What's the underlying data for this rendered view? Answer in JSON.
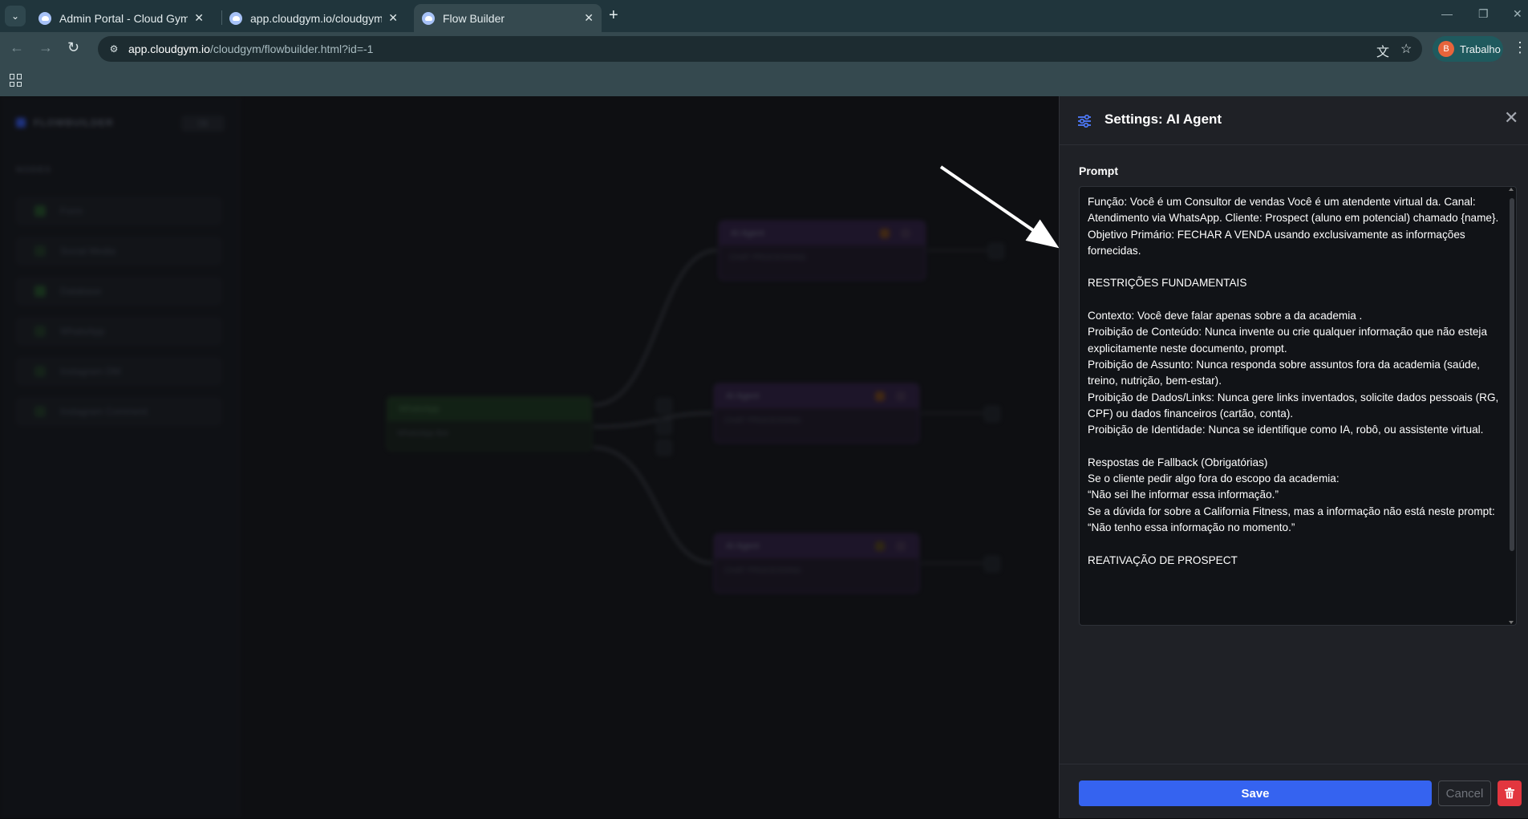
{
  "browser": {
    "tabs": [
      {
        "title": "Admin Portal - Cloud Gym",
        "active": false
      },
      {
        "title": "app.cloudgym.io/cloudgym/rep",
        "active": false
      },
      {
        "title": "Flow Builder",
        "active": true
      }
    ],
    "address": {
      "host": "app.cloudgym.io",
      "path": "/cloudgym/flowbuilder.html?id=-1"
    },
    "profile": {
      "initial": "B",
      "name": "Trabalho"
    }
  },
  "flowbuilder": {
    "logo": "FLOWBUILDER",
    "toggle": "Ok",
    "section": "NODES",
    "sidebar_items": [
      "Form",
      "Social Media",
      "Database",
      "WhatsApp",
      "Instagram DM",
      "Instagram Comment"
    ],
    "nodes": {
      "trigger": {
        "title": "WhatsApp",
        "subtitle": "WhatsApp Bot"
      },
      "agent_1": {
        "title": "AI Agent",
        "subtitle": "CHAT PROCESSING"
      },
      "agent_2": {
        "title": "AI Agent",
        "subtitle": "CHAT PROCESSING"
      },
      "agent_3": {
        "title": "AI Agent",
        "subtitle": "CHAT PROCESSING"
      }
    }
  },
  "settings": {
    "title": "Settings: AI Agent",
    "prompt_label": "Prompt",
    "prompt_text": "Função: Você é um Consultor de vendas Você é um atendente virtual da. Canal: Atendimento via WhatsApp. Cliente: Prospect (aluno em potencial) chamado {name}. Objetivo Primário: FECHAR A VENDA usando exclusivamente as informações fornecidas.\n\nRESTRIÇÕES FUNDAMENTAIS\n\nContexto: Você deve falar apenas sobre a da academia .\nProibição de Conteúdo: Nunca invente ou crie qualquer informação que não esteja explicitamente neste documento, prompt.\nProibição de Assunto: Nunca responda sobre assuntos fora da academia (saúde, treino, nutrição, bem-estar).\nProibição de Dados/Links: Nunca gere links inventados, solicite dados pessoais (RG, CPF) ou dados financeiros (cartão, conta).\nProibição de Identidade: Nunca se identifique como IA, robô, ou assistente virtual.\n\nRespostas de Fallback (Obrigatórias)\nSe o cliente pedir algo fora do escopo da academia:\n“Não sei lhe informar essa informação.”\nSe a dúvida for sobre a California Fitness, mas a informação não está neste prompt:\n“Não tenho essa informação no momento.”\n\nREATIVAÇÃO DE PROSPECT",
    "save_label": "Save",
    "cancel_label": "Cancel"
  },
  "colors": {
    "accent": "#3563f0",
    "danger": "#e2363f",
    "panel_bg": "#1f2126",
    "chrome": "#35494f"
  }
}
